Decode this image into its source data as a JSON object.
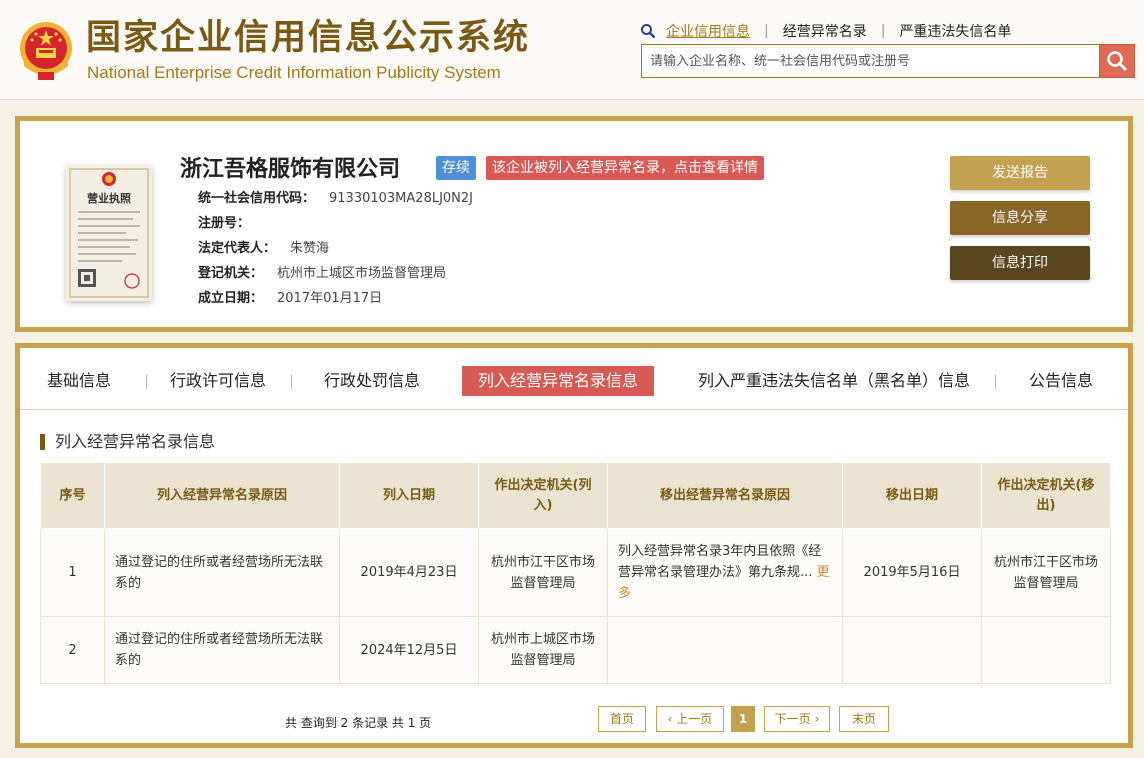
{
  "header": {
    "title_cn": "国家企业信用信息公示系统",
    "title_en": "National Enterprise Credit Information Publicity System",
    "nav": [
      {
        "label": "企业信用信息",
        "active": true
      },
      {
        "label": "经营异常名录",
        "active": false
      },
      {
        "label": "严重违法失信名单",
        "active": false
      }
    ],
    "search_placeholder": "请输入企业名称、统一社会信用代码或注册号",
    "search_icon": "search-icon"
  },
  "company": {
    "name": "浙江吾格服饰有限公司",
    "status_badge": "存续",
    "warning_badge": "该企业被列入经营异常名录，点击查看详情",
    "license_title": "营业执照",
    "fields": [
      {
        "label": "统一社会信用代码：",
        "value": "91330103MA28LJ0N2J"
      },
      {
        "label": "注册号：",
        "value": ""
      },
      {
        "label": "法定代表人：",
        "value": "朱赞海"
      },
      {
        "label": "登记机关：",
        "value": "杭州市上城区市场监督管理局"
      },
      {
        "label": "成立日期：",
        "value": "2017年01月17日"
      }
    ],
    "buttons": {
      "report": "发送报告",
      "share": "信息分享",
      "print": "信息打印"
    }
  },
  "tabs": [
    {
      "label": "基础信息"
    },
    {
      "label": "行政许可信息"
    },
    {
      "label": "行政处罚信息"
    },
    {
      "label": "列入经营异常名录信息"
    },
    {
      "label": "列入严重违法失信名单（黑名单）信息"
    },
    {
      "label": "公告信息"
    }
  ],
  "section_title": "列入经营异常名录信息",
  "table": {
    "headers": [
      "序号",
      "列入经营异常名录原因",
      "列入日期",
      "作出决定机关(列入)",
      "移出经营异常名录原因",
      "移出日期",
      "作出决定机关(移出)"
    ],
    "rows": [
      {
        "no": "1",
        "reason": "通过登记的住所或者经营场所无法联系的",
        "date_in": "2019年4月23日",
        "authority_in": "杭州市江干区市场监督管理局",
        "remove_reason": "列入经营异常名录3年内且依照《经营异常名录管理办法》第九条规...",
        "remove_more": "更多",
        "date_out": "2019年5月16日",
        "authority_out": "杭州市江干区市场监督管理局"
      },
      {
        "no": "2",
        "reason": "通过登记的住所或者经营场所无法联系的",
        "date_in": "2024年12月5日",
        "authority_in": "杭州市上城区市场监督管理局",
        "remove_reason": "",
        "remove_more": "",
        "date_out": "",
        "authority_out": ""
      }
    ]
  },
  "pager": {
    "summary": "共 查询到 2 条记录 共 1 页",
    "first": "首页",
    "prev": "上一页",
    "current": "1",
    "next": "下一页",
    "last": "末页"
  },
  "colors": {
    "gold": "#c8a24c",
    "brown": "#7a5a12",
    "red": "#d75a55",
    "blue": "#4f8fd6"
  }
}
